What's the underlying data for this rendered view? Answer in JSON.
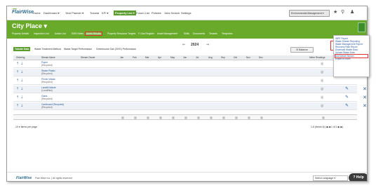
{
  "topnav": {
    "logo": "FlairWise",
    "items": [
      "Home",
      "Dashboard ▾",
      "Year Planner ▾",
      "Tutorial",
      "KPI ▾",
      "Property List ▾",
      "Forum List",
      "Policies",
      "Jobs Search",
      "Settings"
    ],
    "active_index": 5,
    "org_select": "Environmental Management ▾",
    "icons": [
      "star-icon",
      "search-icon",
      "user-add-icon"
    ]
  },
  "page": {
    "title": "City Place ▾",
    "subnav": [
      "Property Details",
      "Inspection List",
      "Action List",
      "EMS Notes",
      "Alerts Results",
      "Property Resource Targets",
      "F-Gas Register",
      "Asset Management",
      "Skills",
      "Documents",
      "Tenants",
      "Templates"
    ],
    "subnav_highlight": 4
  },
  "toolbar": {
    "prev": "⇐",
    "year": "2024",
    "next": "⇒",
    "menu_icon": "☰"
  },
  "tabs": {
    "items": [
      "Tabular Data",
      "Waste Treatment Method",
      "Waste Target Performance",
      "Greenhouse Gas (GHG) Performance"
    ],
    "active_index": 0,
    "balance_label": "⊟ Balance"
  },
  "table": {
    "headers": [
      "Ordering",
      "Stream Name",
      "Stream Owner",
      "Jan",
      "Feb",
      "Mar",
      "Apr",
      "May",
      "Jun",
      "Jul",
      "Aug",
      "Sep",
      "Oct",
      "Nov",
      "Dec",
      "Meter Readings"
    ],
    "rows": [
      {
        "name": "Paper",
        "status": "(Recycled)"
      },
      {
        "name": "Waste Plastic",
        "status": "(Recycled)"
      },
      {
        "name": "Printer Waste",
        "status": "(Recycled)"
      },
      {
        "name": "Landfill Waste",
        "status": "(Landfilled)"
      },
      {
        "name": "Glass",
        "status": "(Recycled)"
      },
      {
        "name": "Cardboard (Recycled)",
        "status": "(Recycled)"
      }
    ]
  },
  "pager": {
    "left": "10 ▾ Items per page",
    "right": "1-6 (Items 6)  |◀  ◀  1 of 1  ▶  ▶|"
  },
  "dropdown": {
    "items": [
      "IMRT Report",
      "Waste Stream Reporting",
      "Waste Management Report",
      "Recovery Rate Report",
      "Download Waste Data",
      "Upload Waste Data",
      "Add Waste Stream",
      "Export to Excel"
    ],
    "highlight": 6
  },
  "footer": {
    "logo": "FlairWise",
    "text": "Flair Wise Inc. | All rights reserved",
    "lang": "Select Language ▾",
    "help": "? Help"
  }
}
